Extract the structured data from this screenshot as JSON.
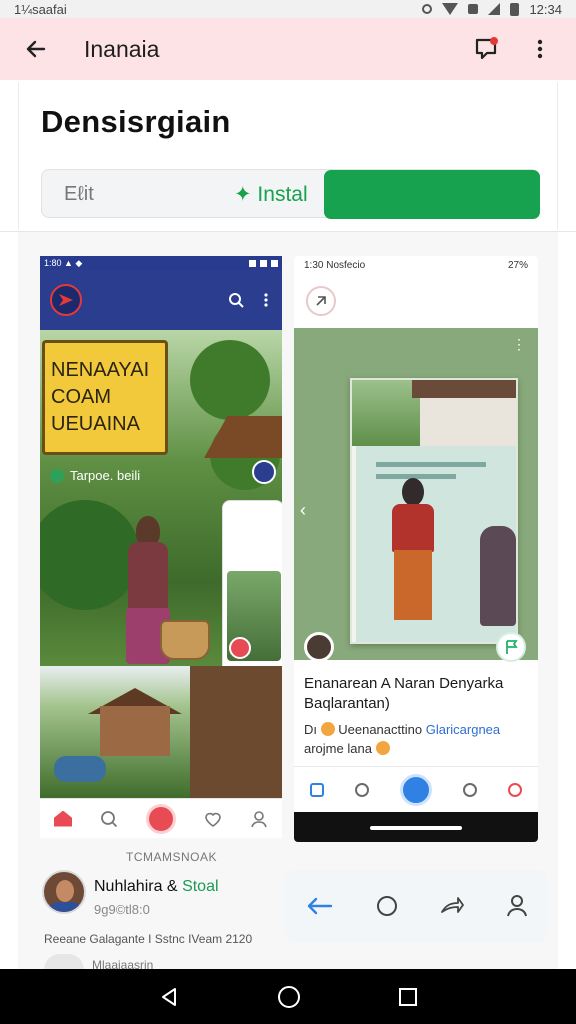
{
  "status_bar": {
    "left_text": "1¼saafai",
    "time": "12:34"
  },
  "app_bar": {
    "title": "Inanaia"
  },
  "app_header": {
    "name": "Densisrgiain",
    "edit_label": "Eℓit",
    "install_label": "✦ Instal"
  },
  "screenshot_left": {
    "status_text": "1:80 ▲ ◆",
    "sign_text": "NENAAYAI COAM UEUAINA",
    "caption": "Tarpoe. beili"
  },
  "screenshot_right": {
    "status_time": "1:30 Nosfecio",
    "status_right": "27%",
    "title": "Enanarean A Naran Denyarka Baqlarantan)",
    "meta_part1": "Dı",
    "meta_part2": "Ueenanacttino",
    "meta_link": "Glaricargnea",
    "meta_part3": "arojme lana"
  },
  "review": {
    "section_label": "TCMAMSNOAK",
    "reviewer_name": "Nuhlahira &",
    "reviewer_badge": "Stoal",
    "reviewer_sub": "9g9©tl8:0",
    "review_text": "Reeane Galagante I Sstnc IVeam 2120",
    "next_text": "Mlaaiaasrin"
  },
  "colors": {
    "appbar_bg": "#fde3e5",
    "install_green": "#16a24f",
    "accent_blue": "#2f82e3"
  }
}
